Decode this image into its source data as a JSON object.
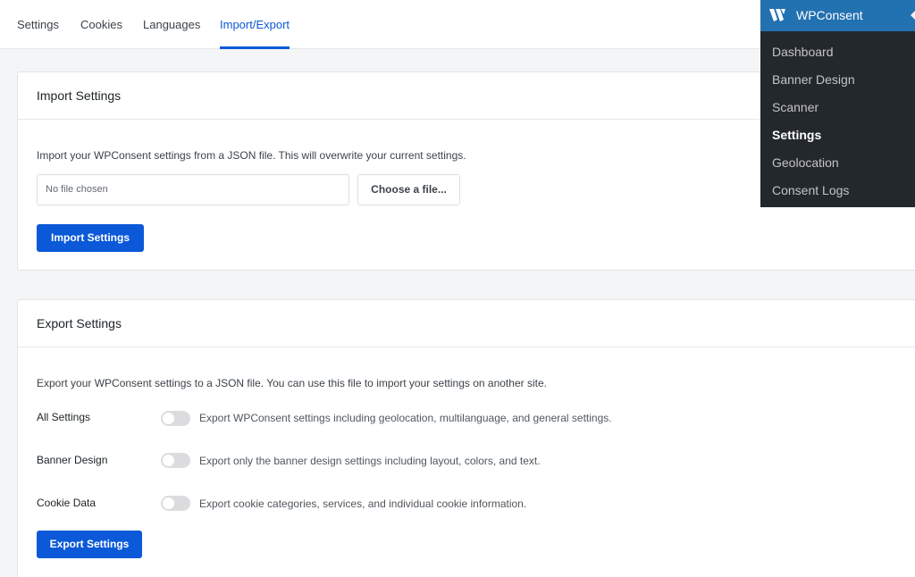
{
  "tabs": [
    "Settings",
    "Cookies",
    "Languages",
    "Import/Export"
  ],
  "active_tab": "Import/Export",
  "import": {
    "title": "Import Settings",
    "description": "Import your WPConsent settings from a JSON file. This will overwrite your current settings.",
    "file_placeholder": "No file chosen",
    "choose_label": "Choose a file...",
    "button_label": "Import Settings"
  },
  "export": {
    "title": "Export Settings",
    "description": "Export your WPConsent settings to a JSON file. You can use this file to import your settings on another site.",
    "rows": [
      {
        "label": "All Settings",
        "description": "Export WPConsent settings including geolocation, multilanguage, and general settings.",
        "enabled": false
      },
      {
        "label": "Banner Design",
        "description": "Export only the banner design settings including layout, colors, and text.",
        "enabled": false
      },
      {
        "label": "Cookie Data",
        "description": "Export cookie categories, services, and individual cookie information.",
        "enabled": false
      }
    ],
    "button_label": "Export Settings"
  },
  "admin_menu": {
    "brand": "WPConsent",
    "brand_icon": "wpconsent-logo-icon",
    "items": [
      "Dashboard",
      "Banner Design",
      "Scanner",
      "Settings",
      "Geolocation",
      "Consent Logs"
    ],
    "current": "Settings"
  },
  "colors": {
    "accent": "#0b59d8",
    "admin_bg": "#23282d",
    "admin_head": "#2271b1"
  }
}
